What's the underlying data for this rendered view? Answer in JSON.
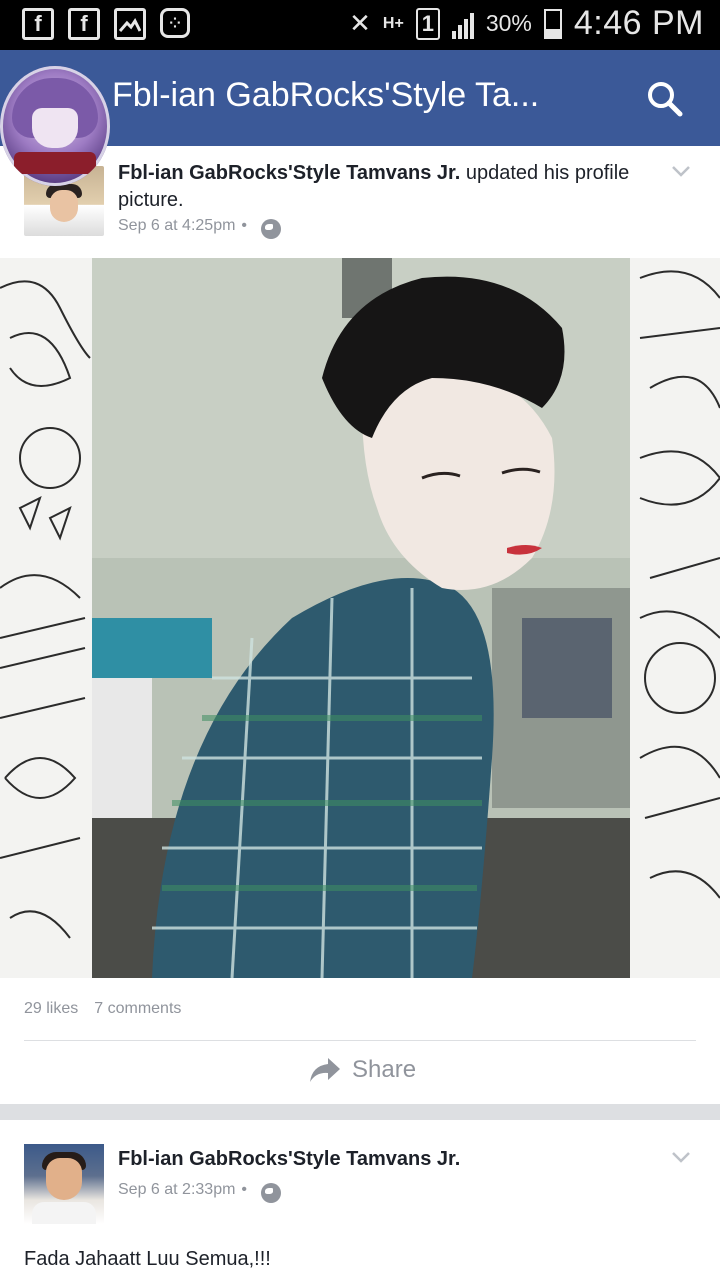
{
  "status_bar": {
    "left_icons": [
      "facebook-notification-icon",
      "facebook-notification-icon",
      "gallery-icon",
      "bbm-icon"
    ],
    "network": "H+",
    "sim": "1",
    "battery_percent": "30%",
    "battery_level": 0.3,
    "time": "4:46 PM"
  },
  "app_bar": {
    "title": "Fbl-ian GabRocks'Style Ta...",
    "search_icon": "search-icon",
    "color": "#3b5998"
  },
  "post1": {
    "author": "Fbl-ian GabRocks'Style Tamvans Jr.",
    "action": " updated his profile picture.",
    "date": "Sep 6 at 4:25pm",
    "separator": "•",
    "privacy_icon": "globe-icon",
    "likes": "29 likes",
    "comments": "7 comments",
    "share_label": "Share"
  },
  "post2": {
    "author": "Fbl-ian GabRocks'Style Tamvans Jr.",
    "date": "Sep 6 at 2:33pm",
    "separator": "•",
    "privacy_icon": "globe-icon",
    "text": "Fada Jahaatt Luu Semua,!!!"
  }
}
